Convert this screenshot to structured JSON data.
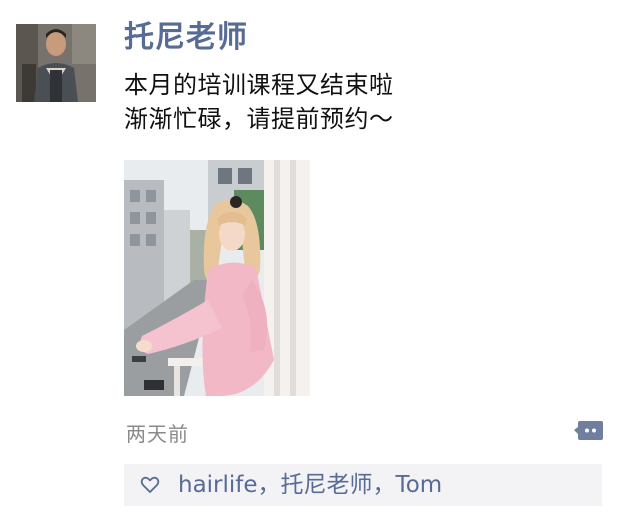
{
  "post": {
    "author": "托尼老师",
    "text_lines": [
      "本月的培训课程又结束啦",
      "渐渐忙碌，请提前预约～"
    ],
    "time": "两天前"
  },
  "likes": {
    "icon": "heart-outline-icon",
    "names": [
      "hairlife",
      "托尼老师",
      "Tom"
    ],
    "separator": "，"
  },
  "icons": {
    "comment": "comment-bubble-icon"
  },
  "colors": {
    "name_link": "#576b95",
    "timestamp": "#8a8a8a",
    "likes_background": "#f3f3f5"
  }
}
